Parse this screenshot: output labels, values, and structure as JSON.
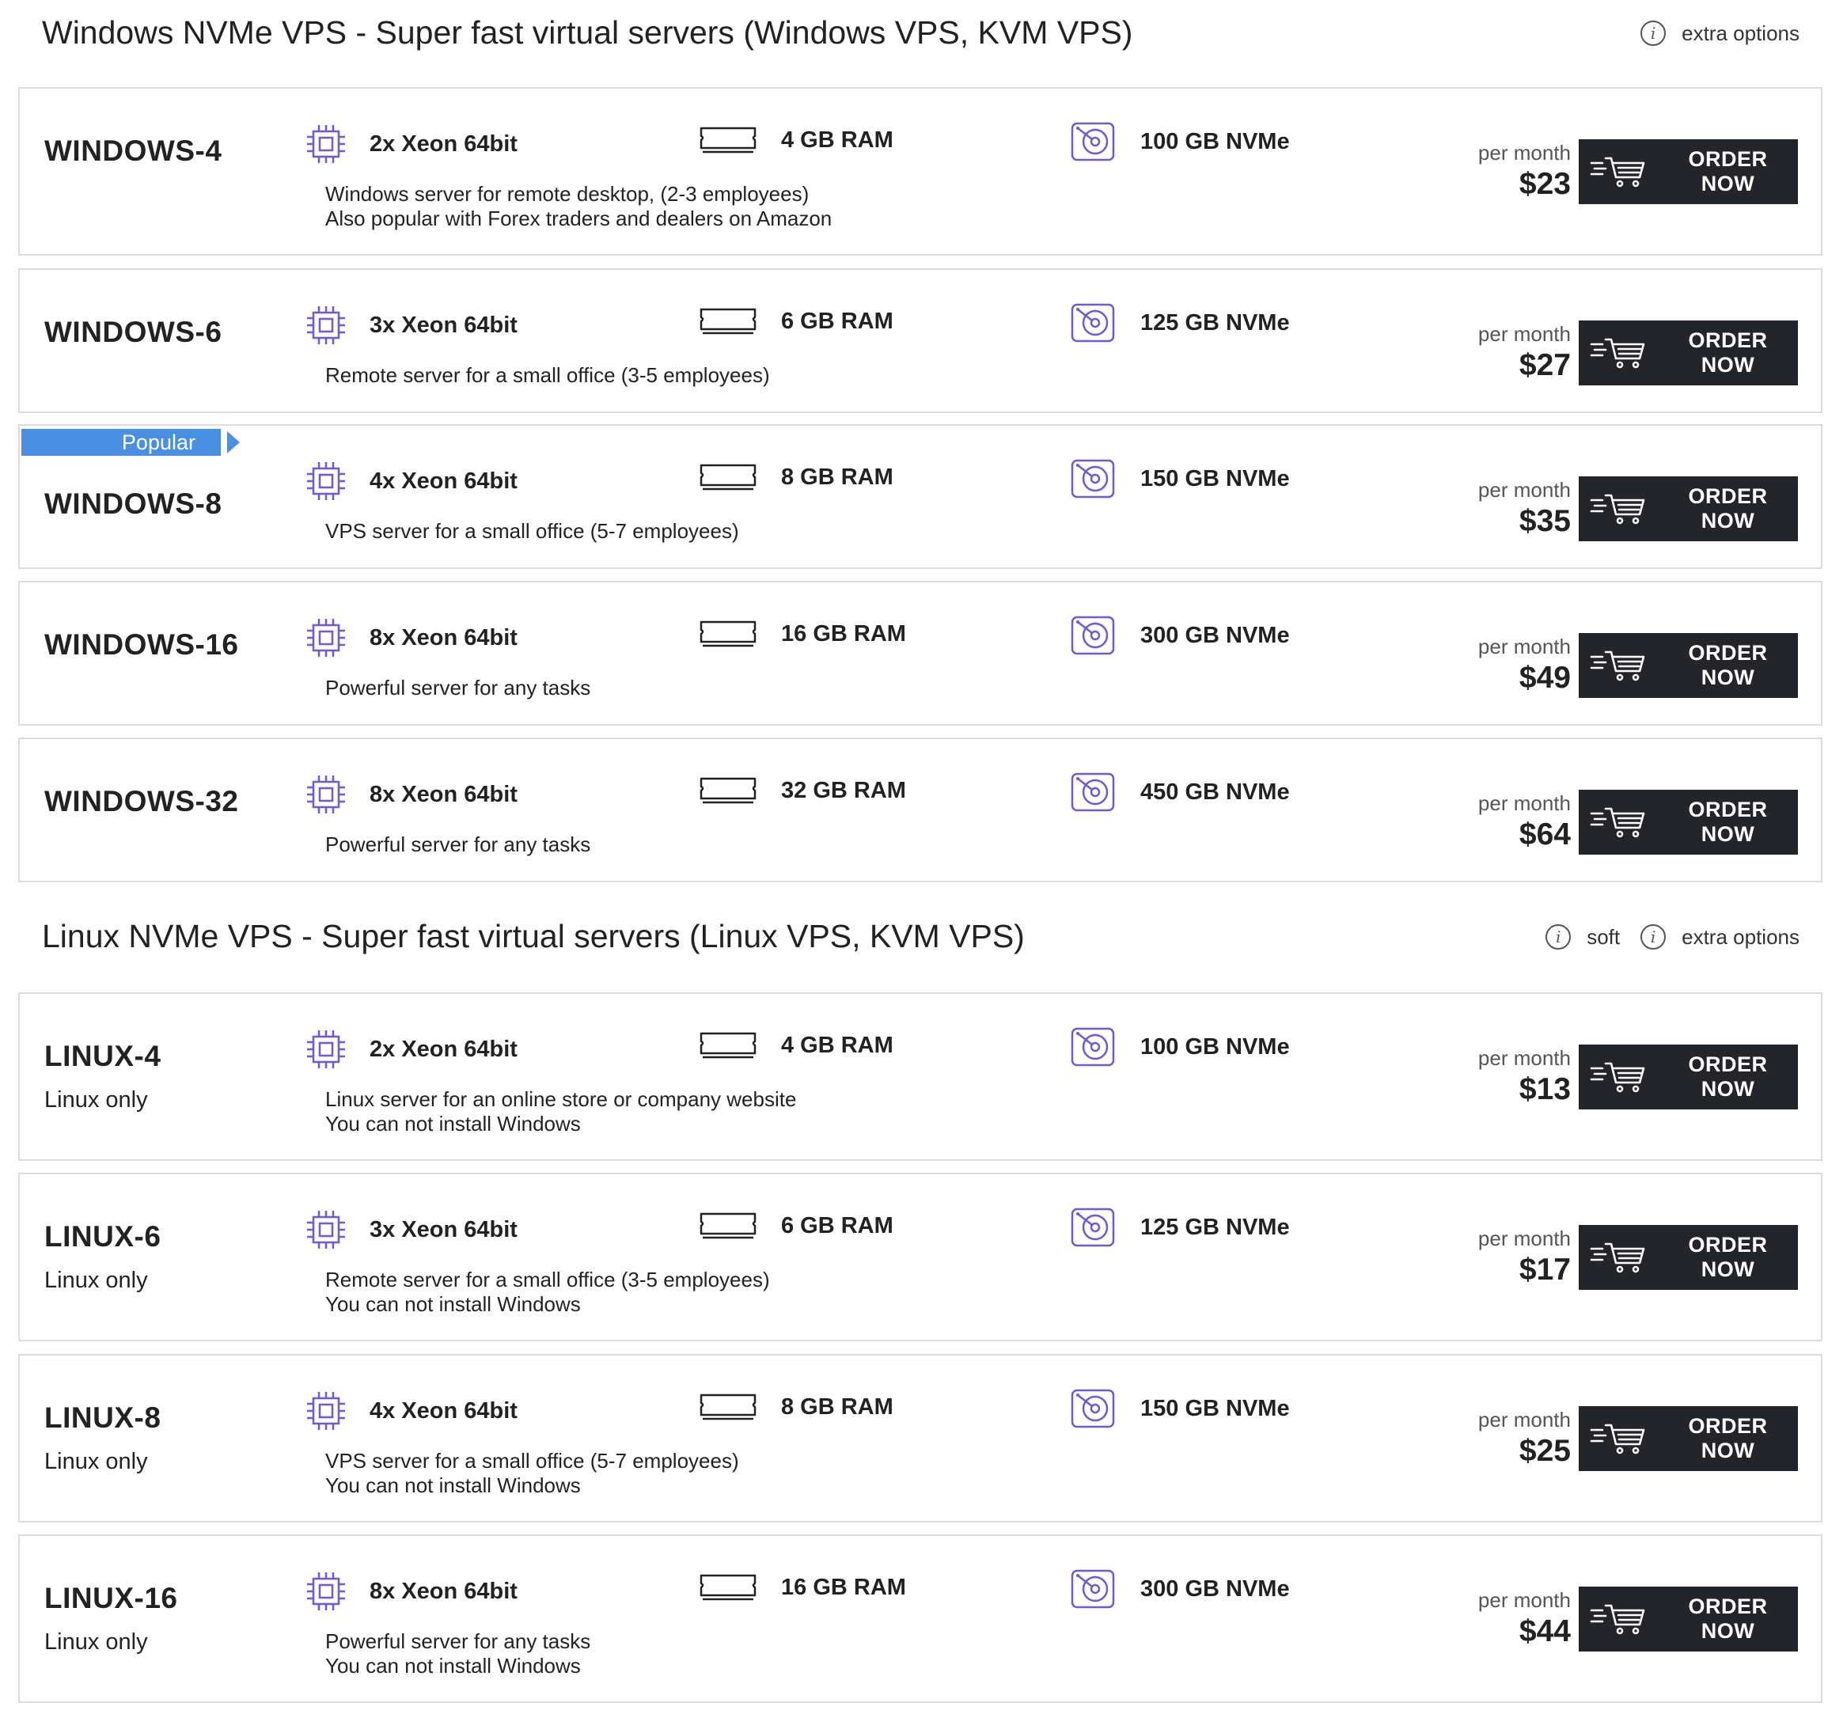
{
  "sections": [
    {
      "title": "Windows NVMe VPS - Super fast virtual servers (Windows VPS, KVM VPS)",
      "options": [
        "extra options"
      ],
      "plans": [
        {
          "name": "WINDOWS-4",
          "cpu": "2x Xeon 64bit",
          "ram": "4 GB RAM",
          "disk": "100 GB NVMe",
          "desc": [
            "Windows server for remote desktop, (2-3 employees)",
            "Also popular with Forex traders and dealers on Amazon"
          ],
          "per_month": "per month",
          "price": "$23",
          "order": "ORDER NOW"
        },
        {
          "name": "WINDOWS-6",
          "cpu": "3x Xeon 64bit",
          "ram": "6 GB RAM",
          "disk": "125 GB NVMe",
          "desc": [
            "Remote server for a small office (3-5 employees)"
          ],
          "per_month": "per month",
          "price": "$27",
          "order": "ORDER NOW"
        },
        {
          "name": "WINDOWS-8",
          "badge": "Popular",
          "cpu": "4x Xeon 64bit",
          "ram": "8 GB RAM",
          "disk": "150 GB NVMe",
          "desc": [
            "VPS server for a small office (5-7 employees)"
          ],
          "per_month": "per month",
          "price": "$35",
          "order": "ORDER NOW"
        },
        {
          "name": "WINDOWS-16",
          "cpu": "8x Xeon 64bit",
          "ram": "16 GB RAM",
          "disk": "300 GB NVMe",
          "desc": [
            "Powerful server for any tasks"
          ],
          "per_month": "per month",
          "price": "$49",
          "order": "ORDER NOW"
        },
        {
          "name": "WINDOWS-32",
          "cpu": "8x Xeon 64bit",
          "ram": "32 GB RAM",
          "disk": "450 GB NVMe",
          "desc": [
            "Powerful server for any tasks"
          ],
          "per_month": "per month",
          "price": "$64",
          "order": "ORDER NOW"
        }
      ]
    },
    {
      "title": "Linux NVMe VPS - Super fast virtual servers (Linux VPS, KVM VPS)",
      "options": [
        "soft",
        "extra options"
      ],
      "plans": [
        {
          "name": "LINUX-4",
          "sub": "Linux only",
          "cpu": "2x Xeon 64bit",
          "ram": "4 GB RAM",
          "disk": "100 GB NVMe",
          "desc": [
            "Linux server for an online store or company website",
            "You can not install Windows"
          ],
          "per_month": "per month",
          "price": "$13",
          "order": "ORDER NOW"
        },
        {
          "name": "LINUX-6",
          "sub": "Linux only",
          "cpu": "3x Xeon 64bit",
          "ram": "6 GB RAM",
          "disk": "125 GB NVMe",
          "desc": [
            "Remote server for a small office (3-5 employees)",
            "You can not install Windows"
          ],
          "per_month": "per month",
          "price": "$17",
          "order": "ORDER NOW"
        },
        {
          "name": "LINUX-8",
          "sub": "Linux only",
          "cpu": "4x Xeon 64bit",
          "ram": "8 GB RAM",
          "disk": "150 GB NVMe",
          "desc": [
            "VPS server for a small office (5-7 employees)",
            "You can not install Windows"
          ],
          "per_month": "per month",
          "price": "$25",
          "order": "ORDER NOW"
        },
        {
          "name": "LINUX-16",
          "sub": "Linux only",
          "cpu": "8x Xeon 64bit",
          "ram": "16 GB RAM",
          "disk": "300 GB NVMe",
          "desc": [
            "Powerful server for any tasks",
            "You can not install Windows"
          ],
          "per_month": "per month",
          "price": "$44",
          "order": "ORDER NOW"
        }
      ]
    }
  ],
  "icons": {
    "cpu": "cpu-chip-icon",
    "ram": "memory-module-icon",
    "disk": "hard-disk-icon",
    "cart": "shopping-cart-icon",
    "info": "info-icon"
  },
  "colors": {
    "icon_accent": "#6b5bd6",
    "badge": "#4a90e2",
    "button_bg": "#24252a",
    "border": "#dcdcdc"
  }
}
